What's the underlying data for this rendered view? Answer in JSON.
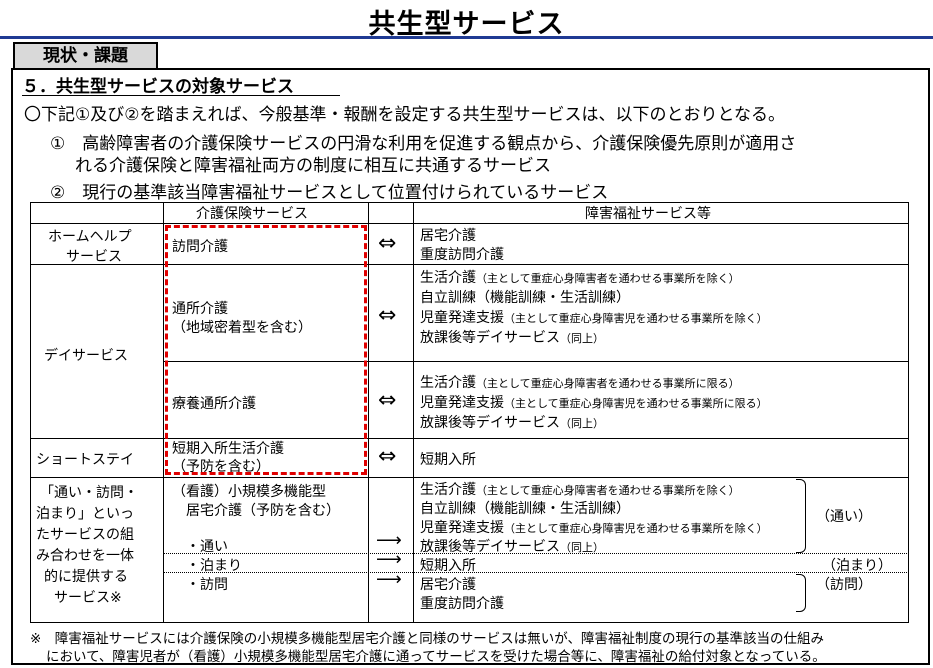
{
  "title": "共生型サービス",
  "badge": "現状・課題",
  "section": "５．共生型サービスの対象サービス",
  "intro": "〇下記①及び②を踏まえれば、今般基準・報酬を設定する共生型サービスは、以下のとおりとなる。",
  "point1_line1": "①　高齢障害者の介護保険サービスの円滑な利用を促進する観点から、介護保険優先原則が適用さ",
  "point1_line2": "れる介護保険と障害福祉両方の制度に相互に共通するサービス",
  "point2": "②　現行の基準該当障害福祉サービスとして位置付けられているサービス",
  "table": {
    "header_kaigo": "介護保険サービス",
    "header_shogai": "障害福祉サービス等",
    "row_homehelp": {
      "label_l1": "ホームヘルプ",
      "label_l2": "サービス",
      "kaigo": "訪問介護",
      "arrow": "⇔",
      "shogai_l1": "居宅介護",
      "shogai_l2": "重度訪問介護"
    },
    "row_day": {
      "label": "デイサービス",
      "a_kaigo_l1": "通所介護",
      "a_kaigo_l2": "（地域密着型を含む）",
      "a_arrow": "⇔",
      "a_s1": "生活介護",
      "a_s1_note": "（主として重症心身障害者を通わせる事業所を除く）",
      "a_s2": "自立訓練（機能訓練・生活訓練）",
      "a_s3": "児童発達支援",
      "a_s3_note": "（主として重症心身障害児を通わせる事業所を除く）",
      "a_s4": "放課後等デイサービス",
      "a_s4_note": "（同上）",
      "b_kaigo": "療養通所介護",
      "b_arrow": "⇔",
      "b_s1": "生活介護",
      "b_s1_note": "（主として重症心身障害者を通わせる事業所に限る）",
      "b_s2": "児童発達支援",
      "b_s2_note": "（主として重症心身障害児を通わせる事業所に限る）",
      "b_s3": "放課後等デイサービス",
      "b_s3_note": "（同上）"
    },
    "row_short": {
      "label": "ショートステイ",
      "kaigo_l1": "短期入所生活介護",
      "kaigo_l2": "（予防を含む）",
      "arrow": "⇔",
      "shogai": "短期入所"
    },
    "row_combo": {
      "label_lines": [
        "「通い・訪問・",
        "泊まり」といっ",
        "たサービスの組",
        "み合わせを一体",
        "的に提供する",
        "サービス※"
      ],
      "kaigo_l1": "（看護）小規模多機能型",
      "kaigo_l2": "居宅介護（予防を含む）",
      "kayoi": "・通い",
      "tomari": "・泊まり",
      "houmon": "・訪問",
      "arrow": "⟶",
      "s1": "生活介護",
      "s1_note": "（主として重症心身障害者を通わせる事業所を除く）",
      "s2": "自立訓練（機能訓練・生活訓練）",
      "s3": "児童発達支援",
      "s3_note": "（主として重症心身障害児を通わせる事業所を除く）",
      "s4": "放課後等デイサービス",
      "s4_note": "（同上）",
      "s5": "短期入所",
      "s6": "居宅介護",
      "s7": "重度訪問介護",
      "tag_kayoi": "（通い）",
      "tag_tomari": "（泊まり）",
      "tag_houmon": "（訪問）"
    }
  },
  "footnote_l1": "※　障害福祉サービスには介護保険の小規模多機能型居宅介護と同様のサービスは無いが、障害福祉制度の現行の基準該当の仕組み",
  "footnote_l2": "において、障害児者が（看護）小規模多機能型居宅介護に通ってサービスを受けた場合等に、障害福祉の給付対象となっている。",
  "colors": {
    "title_rule": "#1f3a93",
    "badge_bg": "#d9d9d9",
    "highlight_border": "#e00000"
  }
}
